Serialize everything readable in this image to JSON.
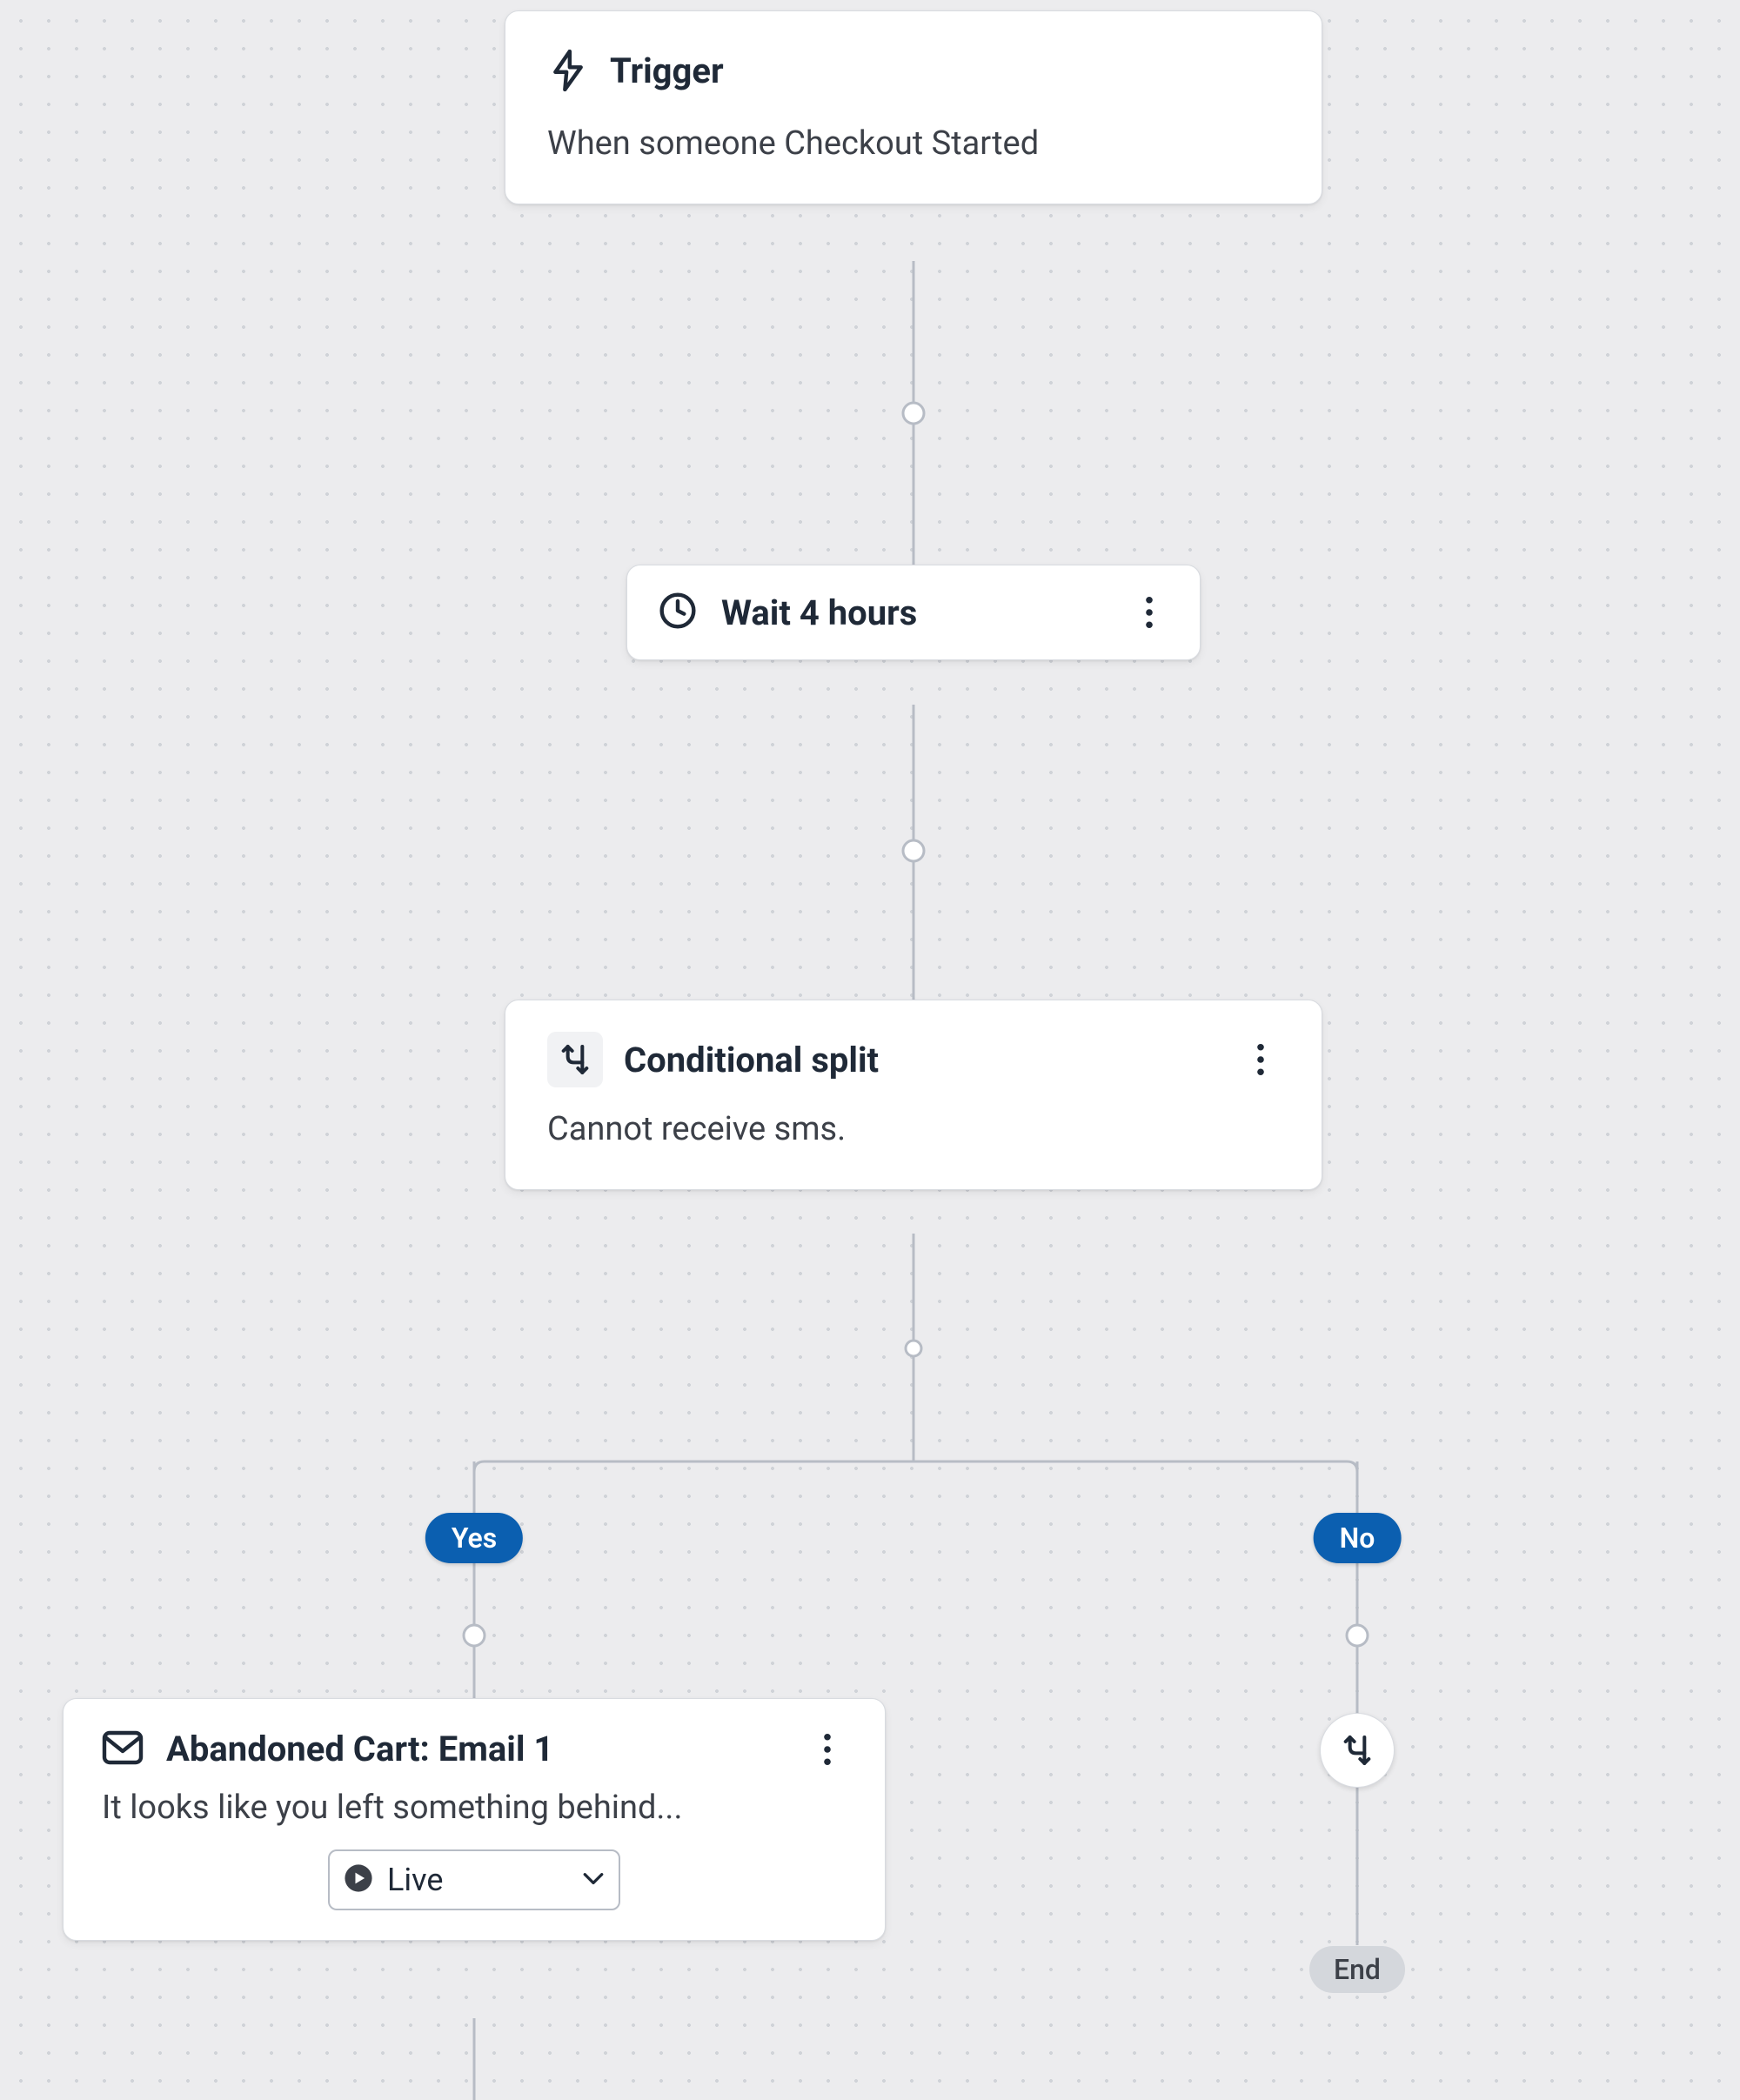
{
  "trigger": {
    "title": "Trigger",
    "description": "When someone Checkout Started"
  },
  "wait": {
    "title": "Wait 4 hours"
  },
  "split": {
    "title": "Conditional split",
    "description": "Cannot receive sms."
  },
  "branches": {
    "yes_label": "Yes",
    "no_label": "No"
  },
  "email_step": {
    "title": "Abandoned Cart: Email 1",
    "description": "It looks like you left something behind...",
    "status_label": "Live"
  },
  "end": {
    "label": "End"
  }
}
